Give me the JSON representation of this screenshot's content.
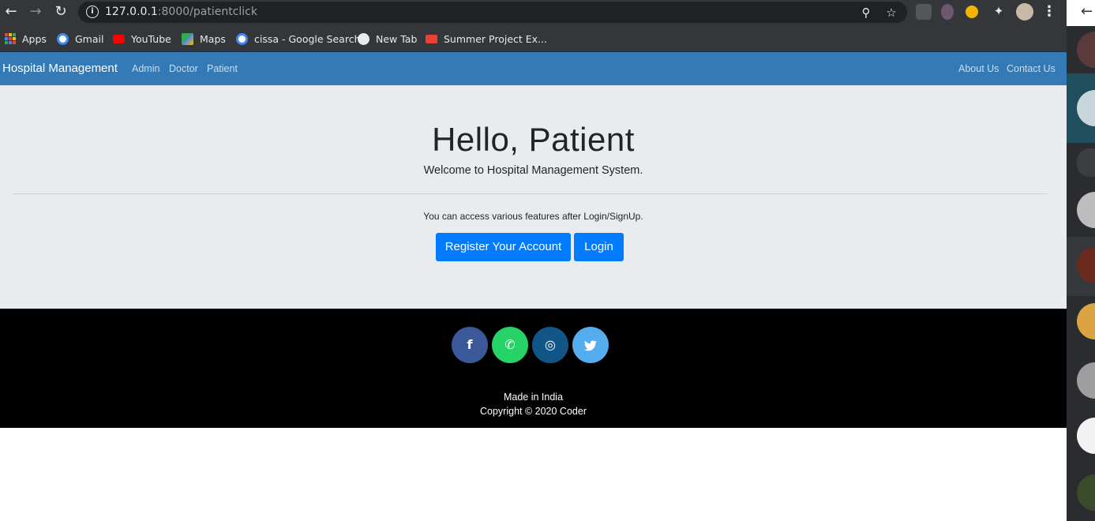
{
  "browser": {
    "url_host": "127.0.0.1",
    "url_rest": ":8000/patientclick",
    "back_glyph": "←",
    "forward_glyph": "→",
    "reload_glyph": "↻",
    "info_glyph": "i",
    "zoom_glyph": "⚲",
    "star_glyph": "☆",
    "puzzle_glyph": "✦",
    "menu_glyph": "⋮"
  },
  "bookmarks": [
    {
      "label": "Apps",
      "icon": "apps-grid-icon"
    },
    {
      "label": "Gmail",
      "icon": "google-icon",
      "color": "#4285f4"
    },
    {
      "label": "YouTube",
      "icon": "youtube-icon",
      "color": "#ff0000"
    },
    {
      "label": "Maps",
      "icon": "maps-icon",
      "color": "#34a853"
    },
    {
      "label": "cissa - Google Search",
      "icon": "google-icon",
      "color": "#4285f4"
    },
    {
      "label": "New Tab",
      "icon": "globe-icon",
      "color": "#e8eaed"
    },
    {
      "label": "Summer Project Ex...",
      "icon": "gmail-icon",
      "color": "#ea4335"
    }
  ],
  "navbar": {
    "brand": "Hospital Management",
    "links": [
      "Admin",
      "Doctor",
      "Patient"
    ],
    "right_links": [
      "About Us",
      "Contact Us"
    ],
    "bg_color": "#337ab7"
  },
  "jumbotron": {
    "title": "Hello, Patient",
    "subtitle": "Welcome to Hospital Management System.",
    "note": "You can access various features after Login/SignUp.",
    "register_label": "Register Your Account",
    "login_label": "Login",
    "button_color": "#007bff"
  },
  "footer": {
    "social": [
      {
        "name": "facebook-icon",
        "glyph": "f",
        "color": "#3b5998"
      },
      {
        "name": "whatsapp-icon",
        "glyph": "✆",
        "color": "#25d366"
      },
      {
        "name": "instagram-icon",
        "glyph": "◎",
        "color": "#125688"
      },
      {
        "name": "twitter-icon",
        "glyph": "🐦",
        "color": "#55acee"
      }
    ],
    "made_in": "Made in India",
    "copyright": "Copyright © 2020 Coder"
  }
}
